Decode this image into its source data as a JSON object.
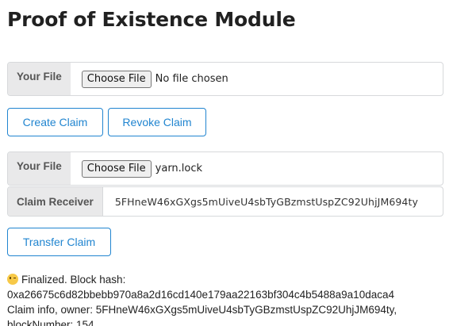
{
  "page": {
    "title": "Proof of Existence Module"
  },
  "create_section": {
    "file_label": "Your File",
    "choose_button": "Choose File",
    "file_status": "No file chosen"
  },
  "actions": {
    "create_claim": "Create Claim",
    "revoke_claim": "Revoke Claim"
  },
  "transfer_section": {
    "file_label": "Your File",
    "choose_button": "Choose File",
    "file_status": "yarn.lock",
    "receiver_label": "Claim Receiver",
    "receiver_value": "5FHneW46xGXgs5mUiveU4sbTyGBzmstUspZC92UhjJM694ty",
    "transfer_button": "Transfer Claim"
  },
  "status": {
    "emoji": "wink-emoji",
    "line1": "Finalized. Block hash:",
    "line2": "0xa26675c6d82bbebb970a8a2d16cd140e179aa22163bf304c4b5488a9a10daca4",
    "line3": "Claim info, owner: 5FHneW46xGXgs5mUiveU4sbTyGBzmstUspZC92UhjJM694ty,",
    "line4": "blockNumber: 154"
  },
  "colors": {
    "accent": "#2185d0",
    "label_bg": "#e9e9ea"
  }
}
